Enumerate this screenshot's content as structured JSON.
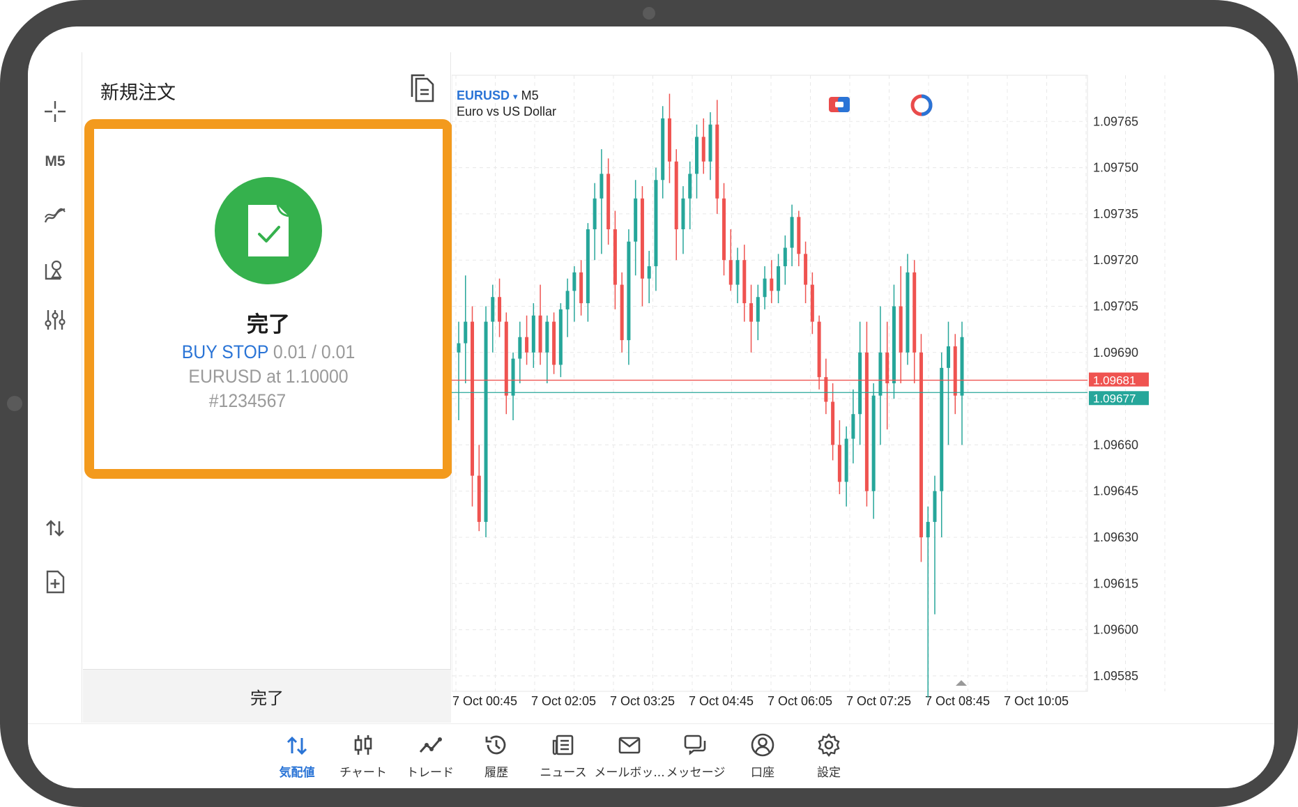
{
  "toolbar": {
    "timeframe": "M5"
  },
  "panel": {
    "title": "新規注文",
    "result_title": "完了",
    "order_type": "BUY STOP",
    "volume": "0.01 / 0.01",
    "symbol_line": "EURUSD at 1.10000",
    "ticket": "#1234567",
    "footer_button": "完了"
  },
  "chart": {
    "symbol": "EURUSD",
    "symbol_arrow": "▾",
    "timeframe": "M5",
    "description": "Euro vs US Dollar",
    "colors": {
      "bull": "#26a69a",
      "bear": "#ef5350",
      "grid": "#e8e8e8",
      "bid_line": "#ef5350",
      "ask_line": "#26a69a"
    }
  },
  "chart_data": {
    "type": "candlestick",
    "y_axis_labels": [
      "1.09765",
      "1.09750",
      "1.09735",
      "1.09720",
      "1.09705",
      "1.09690",
      "1.09675",
      "1.09660",
      "1.09645",
      "1.09630",
      "1.09615",
      "1.09600",
      "1.09585"
    ],
    "x_axis_labels": [
      "7 Oct 00:45",
      "7 Oct 02:05",
      "7 Oct 03:25",
      "7 Oct 04:45",
      "7 Oct 06:05",
      "7 Oct 07:25",
      "7 Oct 08:45",
      "7 Oct 10:05"
    ],
    "ylim": [
      1.0958,
      1.0978
    ],
    "bid": "1.09681",
    "ask": "1.09677",
    "bid_value": 1.09681,
    "ask_value": 1.09677,
    "grid": true,
    "candles": [
      {
        "o": 1.0969,
        "h": 1.097,
        "l": 1.09668,
        "c": 1.09693
      },
      {
        "o": 1.09693,
        "h": 1.09715,
        "l": 1.0968,
        "c": 1.097
      },
      {
        "o": 1.097,
        "h": 1.09705,
        "l": 1.0964,
        "c": 1.0965
      },
      {
        "o": 1.0965,
        "h": 1.0966,
        "l": 1.09632,
        "c": 1.09635
      },
      {
        "o": 1.09635,
        "h": 1.09705,
        "l": 1.0963,
        "c": 1.097
      },
      {
        "o": 1.097,
        "h": 1.09712,
        "l": 1.0969,
        "c": 1.09708
      },
      {
        "o": 1.09708,
        "h": 1.09714,
        "l": 1.09695,
        "c": 1.097
      },
      {
        "o": 1.097,
        "h": 1.09703,
        "l": 1.0967,
        "c": 1.09676
      },
      {
        "o": 1.09676,
        "h": 1.0969,
        "l": 1.09668,
        "c": 1.09688
      },
      {
        "o": 1.09688,
        "h": 1.097,
        "l": 1.0968,
        "c": 1.09695
      },
      {
        "o": 1.09695,
        "h": 1.09702,
        "l": 1.09686,
        "c": 1.0969
      },
      {
        "o": 1.0969,
        "h": 1.09706,
        "l": 1.09685,
        "c": 1.09702
      },
      {
        "o": 1.09702,
        "h": 1.09712,
        "l": 1.09686,
        "c": 1.0969
      },
      {
        "o": 1.0969,
        "h": 1.09702,
        "l": 1.0968,
        "c": 1.097
      },
      {
        "o": 1.097,
        "h": 1.09703,
        "l": 1.09683,
        "c": 1.09686
      },
      {
        "o": 1.09686,
        "h": 1.09706,
        "l": 1.09682,
        "c": 1.09704
      },
      {
        "o": 1.09704,
        "h": 1.09714,
        "l": 1.09695,
        "c": 1.0971
      },
      {
        "o": 1.0971,
        "h": 1.09718,
        "l": 1.097,
        "c": 1.09716
      },
      {
        "o": 1.09716,
        "h": 1.0972,
        "l": 1.09702,
        "c": 1.09706
      },
      {
        "o": 1.09706,
        "h": 1.09732,
        "l": 1.097,
        "c": 1.0973
      },
      {
        "o": 1.0973,
        "h": 1.09745,
        "l": 1.0972,
        "c": 1.0974
      },
      {
        "o": 1.0974,
        "h": 1.09756,
        "l": 1.09722,
        "c": 1.09748
      },
      {
        "o": 1.09748,
        "h": 1.09753,
        "l": 1.09725,
        "c": 1.0973
      },
      {
        "o": 1.0973,
        "h": 1.09736,
        "l": 1.09704,
        "c": 1.09712
      },
      {
        "o": 1.09712,
        "h": 1.09716,
        "l": 1.0969,
        "c": 1.09694
      },
      {
        "o": 1.09694,
        "h": 1.0973,
        "l": 1.09686,
        "c": 1.09726
      },
      {
        "o": 1.09726,
        "h": 1.09746,
        "l": 1.09715,
        "c": 1.0974
      },
      {
        "o": 1.0974,
        "h": 1.09744,
        "l": 1.09705,
        "c": 1.09714
      },
      {
        "o": 1.09714,
        "h": 1.09723,
        "l": 1.09706,
        "c": 1.09718
      },
      {
        "o": 1.09718,
        "h": 1.0975,
        "l": 1.0971,
        "c": 1.09746
      },
      {
        "o": 1.09746,
        "h": 1.0977,
        "l": 1.0974,
        "c": 1.09766
      },
      {
        "o": 1.09766,
        "h": 1.09774,
        "l": 1.09745,
        "c": 1.09752
      },
      {
        "o": 1.09752,
        "h": 1.09756,
        "l": 1.0972,
        "c": 1.0973
      },
      {
        "o": 1.0973,
        "h": 1.09744,
        "l": 1.09722,
        "c": 1.0974
      },
      {
        "o": 1.0974,
        "h": 1.09752,
        "l": 1.0973,
        "c": 1.09748
      },
      {
        "o": 1.09748,
        "h": 1.09764,
        "l": 1.0974,
        "c": 1.0976
      },
      {
        "o": 1.0976,
        "h": 1.09766,
        "l": 1.09748,
        "c": 1.09752
      },
      {
        "o": 1.09752,
        "h": 1.09768,
        "l": 1.09746,
        "c": 1.09764
      },
      {
        "o": 1.09764,
        "h": 1.09772,
        "l": 1.09735,
        "c": 1.0974
      },
      {
        "o": 1.0974,
        "h": 1.09745,
        "l": 1.09715,
        "c": 1.0972
      },
      {
        "o": 1.0972,
        "h": 1.0973,
        "l": 1.0971,
        "c": 1.09712
      },
      {
        "o": 1.09712,
        "h": 1.09724,
        "l": 1.09706,
        "c": 1.0972
      },
      {
        "o": 1.0972,
        "h": 1.09725,
        "l": 1.097,
        "c": 1.09706
      },
      {
        "o": 1.09706,
        "h": 1.09712,
        "l": 1.0969,
        "c": 1.097
      },
      {
        "o": 1.097,
        "h": 1.09712,
        "l": 1.09694,
        "c": 1.09708
      },
      {
        "o": 1.09708,
        "h": 1.09718,
        "l": 1.09704,
        "c": 1.09714
      },
      {
        "o": 1.09714,
        "h": 1.0972,
        "l": 1.09706,
        "c": 1.0971
      },
      {
        "o": 1.0971,
        "h": 1.09722,
        "l": 1.09706,
        "c": 1.09718
      },
      {
        "o": 1.09718,
        "h": 1.09728,
        "l": 1.09712,
        "c": 1.09724
      },
      {
        "o": 1.09724,
        "h": 1.09738,
        "l": 1.09718,
        "c": 1.09734
      },
      {
        "o": 1.09734,
        "h": 1.09736,
        "l": 1.09718,
        "c": 1.09722
      },
      {
        "o": 1.09722,
        "h": 1.09726,
        "l": 1.09706,
        "c": 1.09712
      },
      {
        "o": 1.09712,
        "h": 1.09716,
        "l": 1.09696,
        "c": 1.097
      },
      {
        "o": 1.097,
        "h": 1.09702,
        "l": 1.09678,
        "c": 1.09682
      },
      {
        "o": 1.09682,
        "h": 1.09688,
        "l": 1.0967,
        "c": 1.09674
      },
      {
        "o": 1.09674,
        "h": 1.0968,
        "l": 1.09655,
        "c": 1.0966
      },
      {
        "o": 1.0966,
        "h": 1.09668,
        "l": 1.09644,
        "c": 1.09648
      },
      {
        "o": 1.09648,
        "h": 1.09666,
        "l": 1.0964,
        "c": 1.09662
      },
      {
        "o": 1.09662,
        "h": 1.09678,
        "l": 1.09654,
        "c": 1.0967
      },
      {
        "o": 1.0967,
        "h": 1.097,
        "l": 1.0966,
        "c": 1.0969
      },
      {
        "o": 1.0969,
        "h": 1.097,
        "l": 1.0964,
        "c": 1.09645
      },
      {
        "o": 1.09645,
        "h": 1.0968,
        "l": 1.09636,
        "c": 1.09676
      },
      {
        "o": 1.09676,
        "h": 1.09705,
        "l": 1.0966,
        "c": 1.0969
      },
      {
        "o": 1.0969,
        "h": 1.097,
        "l": 1.09665,
        "c": 1.0968
      },
      {
        "o": 1.0968,
        "h": 1.09712,
        "l": 1.09675,
        "c": 1.09705
      },
      {
        "o": 1.09705,
        "h": 1.09718,
        "l": 1.0968,
        "c": 1.0969
      },
      {
        "o": 1.0969,
        "h": 1.09722,
        "l": 1.09686,
        "c": 1.09716
      },
      {
        "o": 1.09716,
        "h": 1.0972,
        "l": 1.0968,
        "c": 1.0969
      },
      {
        "o": 1.0969,
        "h": 1.09696,
        "l": 1.09622,
        "c": 1.0963
      },
      {
        "o": 1.0963,
        "h": 1.0964,
        "l": 1.09578,
        "c": 1.09635
      },
      {
        "o": 1.09635,
        "h": 1.0965,
        "l": 1.09605,
        "c": 1.09645
      },
      {
        "o": 1.09645,
        "h": 1.0969,
        "l": 1.0963,
        "c": 1.09685
      },
      {
        "o": 1.09685,
        "h": 1.097,
        "l": 1.0966,
        "c": 1.09692
      },
      {
        "o": 1.09692,
        "h": 1.09696,
        "l": 1.0967,
        "c": 1.09676
      },
      {
        "o": 1.09676,
        "h": 1.097,
        "l": 1.0966,
        "c": 1.09695
      }
    ]
  },
  "nav": {
    "items": [
      {
        "label": "気配値",
        "icon": "quotes-icon"
      },
      {
        "label": "チャート",
        "icon": "chart-icon"
      },
      {
        "label": "トレード",
        "icon": "trade-icon"
      },
      {
        "label": "履歴",
        "icon": "history-icon"
      },
      {
        "label": "ニュース",
        "icon": "news-icon"
      },
      {
        "label": "メールボッ...",
        "icon": "mail-icon"
      },
      {
        "label": "メッセージ",
        "icon": "messages-icon"
      },
      {
        "label": "口座",
        "icon": "account-icon"
      },
      {
        "label": "設定",
        "icon": "settings-icon"
      }
    ],
    "active_color": "#2a74d6"
  }
}
